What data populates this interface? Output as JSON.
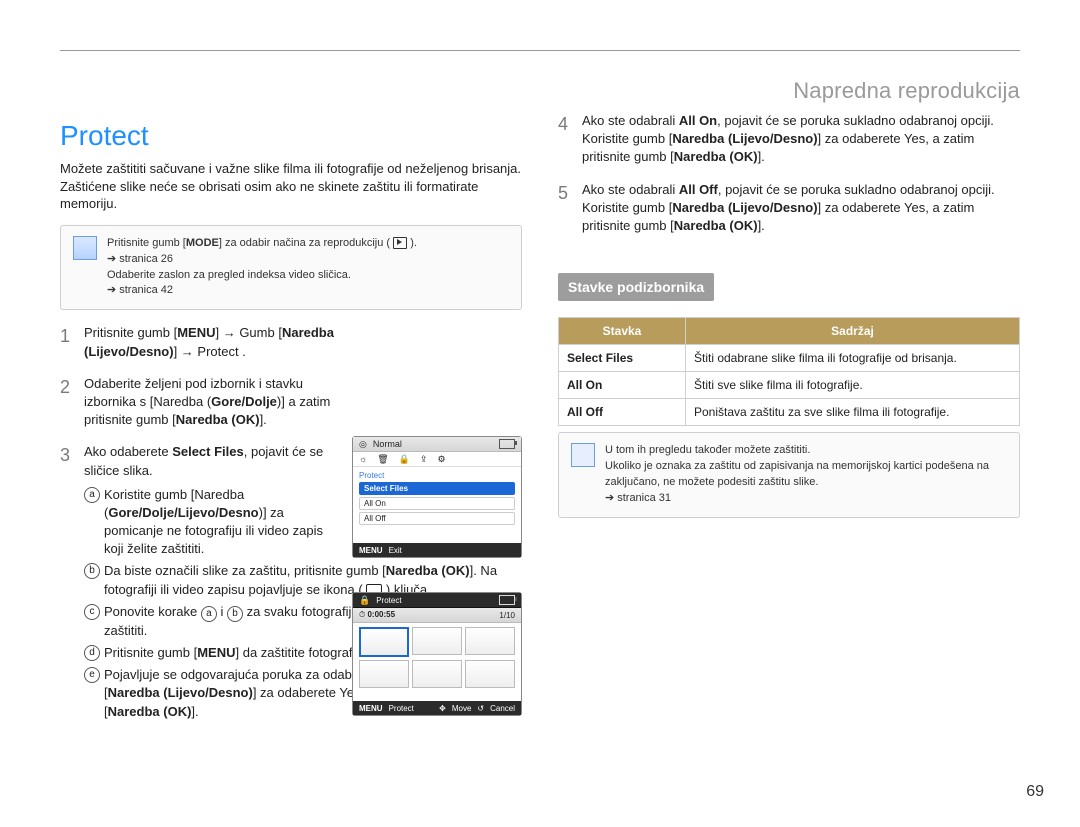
{
  "breadcrumb": "Napredna reprodukcija",
  "title": "Protect",
  "intro": "Možete zaštititi sačuvane i važne slike filma ili fotografije od neželjenog brisanja. Zaštićene slike neće se obrisati osim ako ne skinete zaštitu ili formatirate memoriju.",
  "note1": {
    "l1_a": "Pritisnite gumb [",
    "l1_b": "MODE",
    "l1_c": "] za odabir načina za reprodukciju ( ",
    "l1_d": " ).",
    "ref1": "stranica 26",
    "l2": "Odaberite zaslon za pregled indeksa video sličica.",
    "ref2": "stranica 42"
  },
  "steps": {
    "s1": {
      "a": "Pritisnite gumb [",
      "b": "MENU",
      "c": "] → Gumb [",
      "d": "Naredba (Lijevo/Desno)",
      "e": "] → Protect ."
    },
    "s2": {
      "a": "Odaberite željeni pod izbornik i stavku izbornika s [Naredba (",
      "b": "Gore/Dolje",
      "c": ")] a zatim pritisnite gumb [",
      "d": "Naredba (OK)",
      "e": "]."
    },
    "s3": {
      "lead_a": "Ako odaberete ",
      "lead_b": "Select Files",
      "lead_c": ", pojavit će se sličice slika.",
      "a": {
        "t1": "Koristite gumb [Naredba (",
        "t2": "Gore/Dolje/Lijevo/Desno",
        "t3": ")] za pomicanje ne fotografiju ili video zapis koji želite zaštititi."
      },
      "b": {
        "t1": "Da biste označili slike za zaštitu, pritisnite gumb [",
        "t2": "Naredba (OK)",
        "t3": "]. Na fotografiji ili video zapisu pojavljuje se ikona ( ",
        "t4": " ) ključa."
      },
      "c": {
        "t1": "Ponovite korake ",
        "t2": " i ",
        "t3": " za svaku fotografiju ili video zapis koji želite zaštititi."
      },
      "d": {
        "t1": "Pritisnite gumb [",
        "t2": "MENU",
        "t3": "] da zaštitite fotografije i odabrane video zapise."
      },
      "e": {
        "t1": "Pojavljuje se odgovarajuća poruka za odabranu opciju. Koristite gumb [",
        "t2": "Naredba (Lijevo/Desno)",
        "t3": "] za odaberete Yes, a zatim pritisnite gumb [",
        "t4": "Naredba (OK)",
        "t5": "]."
      }
    },
    "s4": {
      "a": "Ako ste odabrali ",
      "b": "All On",
      "c": ", pojavit će se poruka sukladno odabranoj opciji. Koristite gumb [",
      "d": "Naredba (Lijevo/Desno)",
      "e": "] za odaberete Yes, a zatim pritisnite gumb [",
      "f": "Naredba (OK)",
      "g": "]."
    },
    "s5": {
      "a": "Ako ste odabrali ",
      "b": "All Off",
      "c": ", pojavit će se poruka sukladno odabranoj opciji. Koristite gumb [",
      "d": "Naredba (Lijevo/Desno)",
      "e": "] za odaberete Yes, a zatim pritisnite gumb [",
      "f": "Naredba (OK)",
      "g": "]."
    }
  },
  "lcd_menu": {
    "top": "Normal",
    "header": "Protect",
    "items": [
      "Select Files",
      "All On",
      "All Off"
    ],
    "exit_pre": "MENU",
    "exit": "Exit"
  },
  "lcd_thumb": {
    "header": "Protect",
    "time": "0:00:55",
    "counter": "1/10",
    "f1a": "MENU",
    "f1": "Protect",
    "f2": "Move",
    "f3": "Cancel"
  },
  "subheader": "Stavke podizbornika",
  "table": {
    "h1": "Stavka",
    "h2": "Sadržaj",
    "rows": [
      {
        "k": "Select Files",
        "v": "Štiti odabrane slike filma ili fotografije od brisanja."
      },
      {
        "k": "All On",
        "v": "Štiti sve slike filma ili fotografije."
      },
      {
        "k": "All Off",
        "v": "Poništava zaštitu za sve slike filma ili fotografije."
      }
    ]
  },
  "note2": {
    "l1": "U tom ih pregledu također možete zaštititi.",
    "l2": "Ukoliko je oznaka za zaštitu od zapisivanja na memorijskoj kartici podešena na zaključano, ne možete podesiti zaštitu slike.",
    "ref": "stranica 31"
  },
  "page_no": "69",
  "sub_labels": {
    "a": "a",
    "b": "b"
  }
}
